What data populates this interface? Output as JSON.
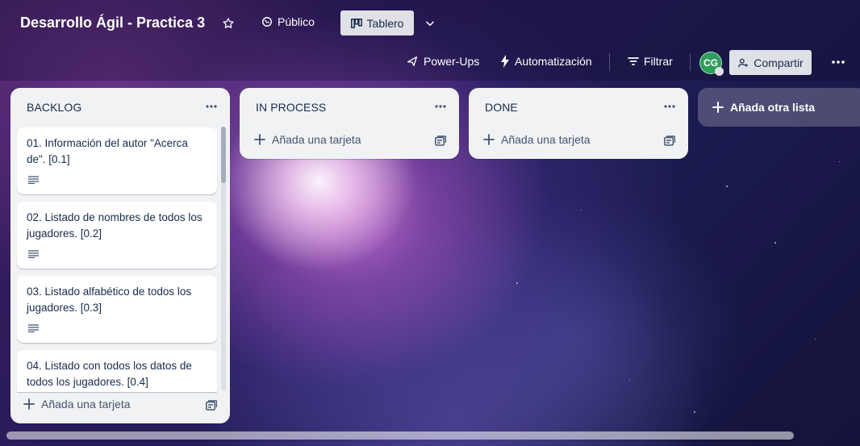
{
  "board": {
    "title": "Desarrollo Ágil - Practica 3",
    "visibility": "Público",
    "view": "Tablero"
  },
  "toolbar": {
    "power_ups": "Power-Ups",
    "automation": "Automatización",
    "filter": "Filtrar",
    "share": "Compartir",
    "avatar_initials": "CG"
  },
  "lists": [
    {
      "name": "BACKLOG",
      "cards": [
        {
          "title": "01. Información del autor \"Acerca de\". [0.1]"
        },
        {
          "title": "02. Listado de nombres de todos los jugadores. [0.2]"
        },
        {
          "title": "03. Listado alfabético de todos los jugadores. [0.3]"
        },
        {
          "title": "04. Listado con todos los datos de todos los jugadores. [0.4]"
        }
      ],
      "add_card": "Añada una tarjeta"
    },
    {
      "name": "IN PROCESS",
      "cards": [],
      "add_card": "Añada una tarjeta"
    },
    {
      "name": "DONE",
      "cards": [],
      "add_card": "Añada una tarjeta"
    }
  ],
  "add_list": "Añada otra lista",
  "colors": {
    "list_bg": "#f1f2f4",
    "text": "#172b4d",
    "avatar": "#2e9e5b",
    "button_bg": "#dfe1e6"
  }
}
